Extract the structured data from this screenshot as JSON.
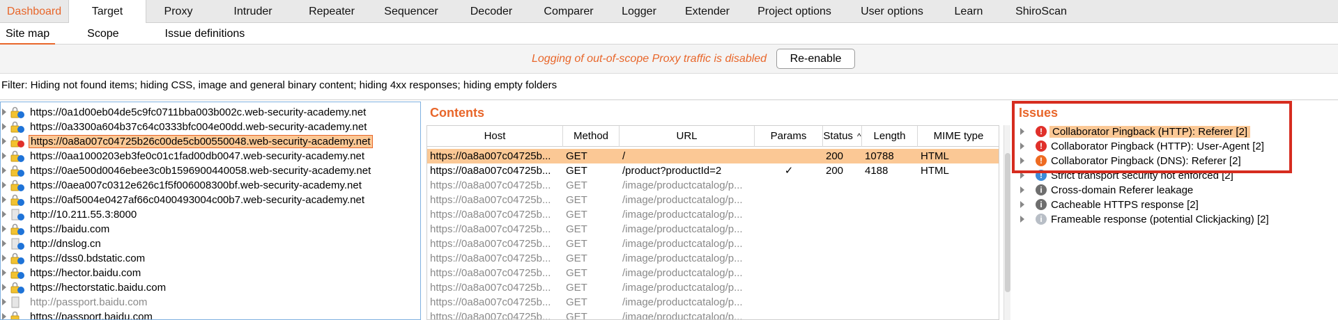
{
  "main_tabs": [
    {
      "label": "Dashboard",
      "state": "dashboard"
    },
    {
      "label": "Target",
      "state": "active"
    },
    {
      "label": "Proxy",
      "state": ""
    },
    {
      "label": "Intruder",
      "state": ""
    },
    {
      "label": "Repeater",
      "state": ""
    },
    {
      "label": "Sequencer",
      "state": ""
    },
    {
      "label": "Decoder",
      "state": ""
    },
    {
      "label": "Comparer",
      "state": ""
    },
    {
      "label": "Logger",
      "state": ""
    },
    {
      "label": "Extender",
      "state": ""
    },
    {
      "label": "Project options",
      "state": ""
    },
    {
      "label": "User options",
      "state": ""
    },
    {
      "label": "Learn",
      "state": ""
    },
    {
      "label": "ShiroScan",
      "state": ""
    }
  ],
  "sub_tabs": [
    {
      "label": "Site map",
      "state": "active"
    },
    {
      "label": "Scope",
      "state": ""
    },
    {
      "label": "Issue definitions",
      "state": ""
    }
  ],
  "notice": {
    "text": "Logging of out-of-scope Proxy traffic is disabled",
    "button": "Re-enable"
  },
  "filter": {
    "text": "Filter: Hiding not found items;  hiding CSS, image and general binary content;  hiding 4xx responses;  hiding empty folders"
  },
  "site_tree": [
    {
      "label": "https://0a1d00eb04de5c9fc0711bba003b002c.web-security-academy.net",
      "icon": "lock-blue-dot-icon",
      "selected": false,
      "dim": false
    },
    {
      "label": "https://0a3300a604b37c64c0333bfc004e00dd.web-security-academy.net",
      "icon": "lock-blue-dot-icon",
      "selected": false,
      "dim": false
    },
    {
      "label": "https://0a8a007c04725b26c00de5cb00550048.web-security-academy.net",
      "icon": "lock-red-dot-icon",
      "selected": true,
      "dim": false
    },
    {
      "label": "https://0aa1000203eb3fe0c01c1fad00db0047.web-security-academy.net",
      "icon": "lock-blue-dot-icon",
      "selected": false,
      "dim": false
    },
    {
      "label": "https://0ae500d0046ebee3c0b1596900440058.web-security-academy.net",
      "icon": "lock-blue-dot-icon",
      "selected": false,
      "dim": false
    },
    {
      "label": "https://0aea007c0312e626c1f5f006008300bf.web-security-academy.net",
      "icon": "lock-blue-dot-icon",
      "selected": false,
      "dim": false
    },
    {
      "label": "https://0af5004e0427af66c0400493004c00b7.web-security-academy.net",
      "icon": "lock-blue-dot-icon",
      "selected": false,
      "dim": false
    },
    {
      "label": "http://10.211.55.3:8000",
      "icon": "page-blue-dot-icon",
      "selected": false,
      "dim": false
    },
    {
      "label": "https://baidu.com",
      "icon": "lock-blue-dot-icon",
      "selected": false,
      "dim": false
    },
    {
      "label": "http://dnslog.cn",
      "icon": "page-blue-dot-icon",
      "selected": false,
      "dim": false
    },
    {
      "label": "https://dss0.bdstatic.com",
      "icon": "lock-blue-dot-icon",
      "selected": false,
      "dim": false
    },
    {
      "label": "https://hector.baidu.com",
      "icon": "lock-blue-dot-icon",
      "selected": false,
      "dim": false
    },
    {
      "label": "https://hectorstatic.baidu.com",
      "icon": "lock-blue-dot-icon",
      "selected": false,
      "dim": false
    },
    {
      "label": "http://passport.baidu.com",
      "icon": "page-grey-icon",
      "selected": false,
      "dim": true
    },
    {
      "label": "https://passport.baidu.com",
      "icon": "lock-icon",
      "selected": false,
      "dim": false
    }
  ],
  "contents": {
    "title": "Contents",
    "columns": [
      "Host",
      "Method",
      "URL",
      "Params",
      "Status",
      "Length",
      "MIME type"
    ],
    "sort_indicator": "^",
    "rows": [
      {
        "host": "https://0a8a007c04725b...",
        "method": "GET",
        "url": "/",
        "params": "",
        "status": "200",
        "length": "10788",
        "mime": "HTML",
        "selected": true,
        "dim": false
      },
      {
        "host": "https://0a8a007c04725b...",
        "method": "GET",
        "url": "/product?productId=2",
        "params": "✓",
        "status": "200",
        "length": "4188",
        "mime": "HTML",
        "selected": false,
        "dim": false
      },
      {
        "host": "https://0a8a007c04725b...",
        "method": "GET",
        "url": "/image/productcatalog/p...",
        "params": "",
        "status": "",
        "length": "",
        "mime": "",
        "selected": false,
        "dim": true
      },
      {
        "host": "https://0a8a007c04725b...",
        "method": "GET",
        "url": "/image/productcatalog/p...",
        "params": "",
        "status": "",
        "length": "",
        "mime": "",
        "selected": false,
        "dim": true
      },
      {
        "host": "https://0a8a007c04725b...",
        "method": "GET",
        "url": "/image/productcatalog/p...",
        "params": "",
        "status": "",
        "length": "",
        "mime": "",
        "selected": false,
        "dim": true
      },
      {
        "host": "https://0a8a007c04725b...",
        "method": "GET",
        "url": "/image/productcatalog/p...",
        "params": "",
        "status": "",
        "length": "",
        "mime": "",
        "selected": false,
        "dim": true
      },
      {
        "host": "https://0a8a007c04725b...",
        "method": "GET",
        "url": "/image/productcatalog/p...",
        "params": "",
        "status": "",
        "length": "",
        "mime": "",
        "selected": false,
        "dim": true
      },
      {
        "host": "https://0a8a007c04725b...",
        "method": "GET",
        "url": "/image/productcatalog/p...",
        "params": "",
        "status": "",
        "length": "",
        "mime": "",
        "selected": false,
        "dim": true
      },
      {
        "host": "https://0a8a007c04725b...",
        "method": "GET",
        "url": "/image/productcatalog/p...",
        "params": "",
        "status": "",
        "length": "",
        "mime": "",
        "selected": false,
        "dim": true
      },
      {
        "host": "https://0a8a007c04725b...",
        "method": "GET",
        "url": "/image/productcatalog/p...",
        "params": "",
        "status": "",
        "length": "",
        "mime": "",
        "selected": false,
        "dim": true
      },
      {
        "host": "https://0a8a007c04725b...",
        "method": "GET",
        "url": "/image/productcatalog/p...",
        "params": "",
        "status": "",
        "length": "",
        "mime": "",
        "selected": false,
        "dim": true
      },
      {
        "host": "https://0a8a007c04725b...",
        "method": "GET",
        "url": "/image/productcatalog/p...",
        "params": "",
        "status": "",
        "length": "",
        "mime": "",
        "selected": false,
        "dim": true
      }
    ]
  },
  "issues": {
    "title": "Issues",
    "items": [
      {
        "label": "Collaborator Pingback (HTTP): Referer [2]",
        "severity": "high",
        "selected": true
      },
      {
        "label": "Collaborator Pingback (HTTP): User-Agent [2]",
        "severity": "high",
        "selected": false
      },
      {
        "label": "Collaborator Pingback (DNS): Referer [2]",
        "severity": "med",
        "selected": false
      },
      {
        "label": "Strict transport security not enforced [2]",
        "severity": "low",
        "selected": false
      },
      {
        "label": "Cross-domain Referer leakage",
        "severity": "info",
        "selected": false
      },
      {
        "label": "Cacheable HTTPS response [2]",
        "severity": "info",
        "selected": false
      },
      {
        "label": "Frameable response (potential Clickjacking) [2]",
        "severity": "infolight",
        "selected": false
      }
    ]
  },
  "colors": {
    "accent": "#e8662a",
    "selection": "#fbc895",
    "annotation_box": "#d62c1f",
    "panel_border": "#7fb0e0"
  }
}
